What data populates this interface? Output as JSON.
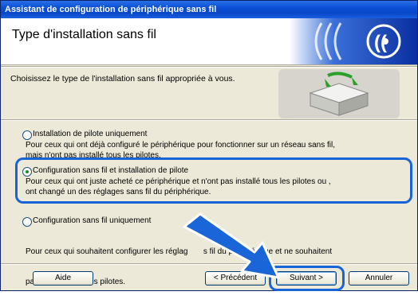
{
  "window": {
    "title": "Assistant de configuration de périphérique sans fil"
  },
  "header": {
    "title": "Type d'installation sans fil",
    "logo_icon": "wireless-signal-icon"
  },
  "prompt": "Choisissez le type de l'installation sans fil appropriée à vous.",
  "options": [
    {
      "title": "Installation de pilote uniquement",
      "desc1": "Pour ceux qui ont déjà configuré le périphérique pour fonctionner sur un réseau sans fil,",
      "desc2": "mais n'ont pas installé tous les pilotes.",
      "selected": false
    },
    {
      "title": "Configuration sans fil et installation de pilote",
      "desc1": "Pour ceux qui ont juste acheté ce périphérique et n'ont pas installé tous les pilotes ou ,",
      "desc2": "ont changé un des réglages sans fil du périphérique.",
      "selected": true
    },
    {
      "title": "Configuration sans fil uniquement",
      "desc1": "Pour ceux qui souhaitent configurer les réglag       s fil du périphérique et ne souhaitent",
      "desc2": "pas installer tous les pilotes.",
      "selected": false
    }
  ],
  "buttons": {
    "help": "Aide",
    "back": "< Précédent",
    "next": "Suivant >",
    "cancel": "Annuler"
  },
  "colors": {
    "highlight": "#1764d6",
    "titlebar": "#0a4fd4",
    "selected_dot": "#1a8f1a"
  }
}
